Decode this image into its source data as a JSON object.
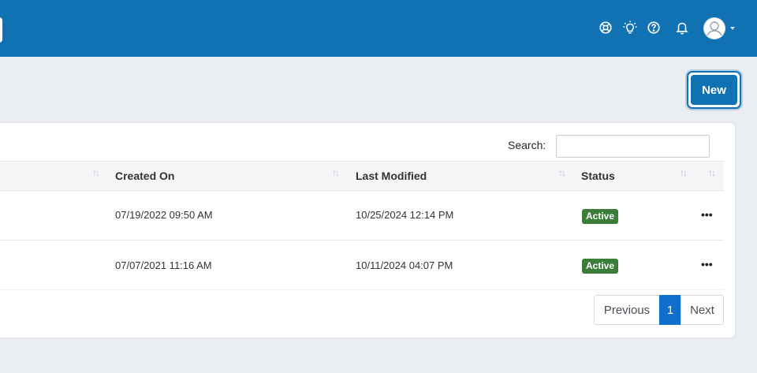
{
  "header": {
    "icons": [
      "lifebuoy-icon",
      "lightbulb-icon",
      "help-icon",
      "bell-icon"
    ],
    "avatar_icon": "user-avatar-icon",
    "brand_color": "#1172b3"
  },
  "toolbar": {
    "new_label": "New"
  },
  "table": {
    "search_label": "Search:",
    "search_value": "",
    "columns": [
      "Created On",
      "Last Modified",
      "Status"
    ],
    "rows": [
      {
        "created_on": "07/19/2022 09:50 AM",
        "last_modified": "10/25/2024 12:14 PM",
        "status": "Active",
        "actions": "•••"
      },
      {
        "created_on": "07/07/2021 11:16 AM",
        "last_modified": "10/11/2024 04:07 PM",
        "status": "Active",
        "actions": "•••"
      }
    ],
    "status_color": "#3c7d3a"
  },
  "pagination": {
    "previous_label": "Previous",
    "current_page": "1",
    "next_label": "Next"
  }
}
